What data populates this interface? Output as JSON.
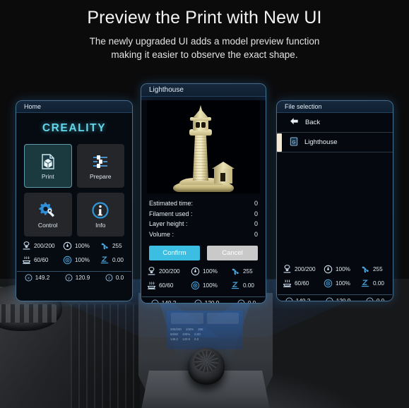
{
  "header": {
    "title": "Preview the Print with New UI",
    "subtitle_line1": "The newly upgraded UI adds a model preview function",
    "subtitle_line2": "making it easier to observe the exact shape."
  },
  "colors": {
    "accent_cyan": "#3cbee3",
    "logo_cyan": "#63d6e8",
    "panel_border": "#78bee b",
    "cancel_gray": "#c9c9c9",
    "model_tan": "#ece4b8",
    "beam_blue": "#3a82dc"
  },
  "home_panel": {
    "title": "Home",
    "logo": "CREALITY",
    "tiles": [
      {
        "label": "Print",
        "icon": "print-file-cube-icon",
        "selected": true
      },
      {
        "label": "Prepare",
        "icon": "sliders-icon",
        "selected": false
      },
      {
        "label": "Control",
        "icon": "gear-wrench-icon",
        "selected": false
      },
      {
        "label": "Info",
        "icon": "info-circle-icon",
        "selected": false
      }
    ]
  },
  "preview_panel": {
    "title": "Lighthouse",
    "model_name": "lighthouse-3d-model",
    "info": [
      {
        "label": "Estimated time:",
        "value": "0"
      },
      {
        "label": "Filament used :",
        "value": "0"
      },
      {
        "label": "Layer height :",
        "value": "0"
      },
      {
        "label": "Volume :",
        "value": "0"
      }
    ],
    "confirm_label": "Confirm",
    "cancel_label": "Cancel"
  },
  "files_panel": {
    "title": "File selection",
    "back_label": "Back",
    "items": [
      {
        "label": "Lighthouse",
        "icon": "file-gcode-icon",
        "selected": true
      }
    ]
  },
  "status_bar": {
    "nozzle_temp": "200/200",
    "speed_pct": "100%",
    "fan_speed": "255",
    "bed_temp": "60/60",
    "flow_pct": "100%",
    "z_offset": "0.00",
    "pos_x": "149.2",
    "pos_y": "120.9",
    "pos_z": "0.0"
  }
}
